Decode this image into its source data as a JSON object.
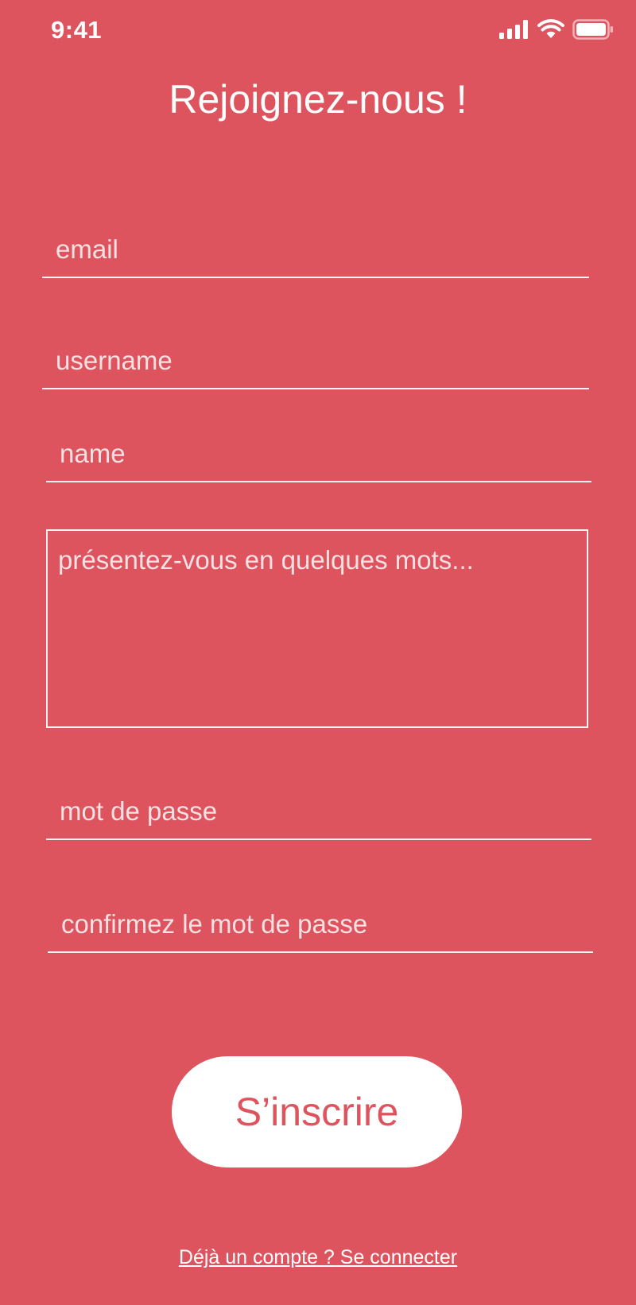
{
  "status_bar": {
    "time": "9:41",
    "icons": [
      "cellular-signal-icon",
      "wifi-icon",
      "battery-icon"
    ]
  },
  "title": "Rejoignez-nous !",
  "form": {
    "email_placeholder": "email",
    "username_placeholder": "username",
    "name_placeholder": "name",
    "bio_placeholder": "présentez-vous en quelques mots...",
    "password_placeholder": "mot de passe",
    "confirm_password_placeholder": "confirmez le mot de passe"
  },
  "submit_label": "S’inscrire",
  "login_link": "Déjà un compte ? Se connecter",
  "colors": {
    "background": "#DD545E",
    "button_bg": "#FFFFFF",
    "button_text": "#DD545E",
    "text": "#FFFFFF"
  }
}
